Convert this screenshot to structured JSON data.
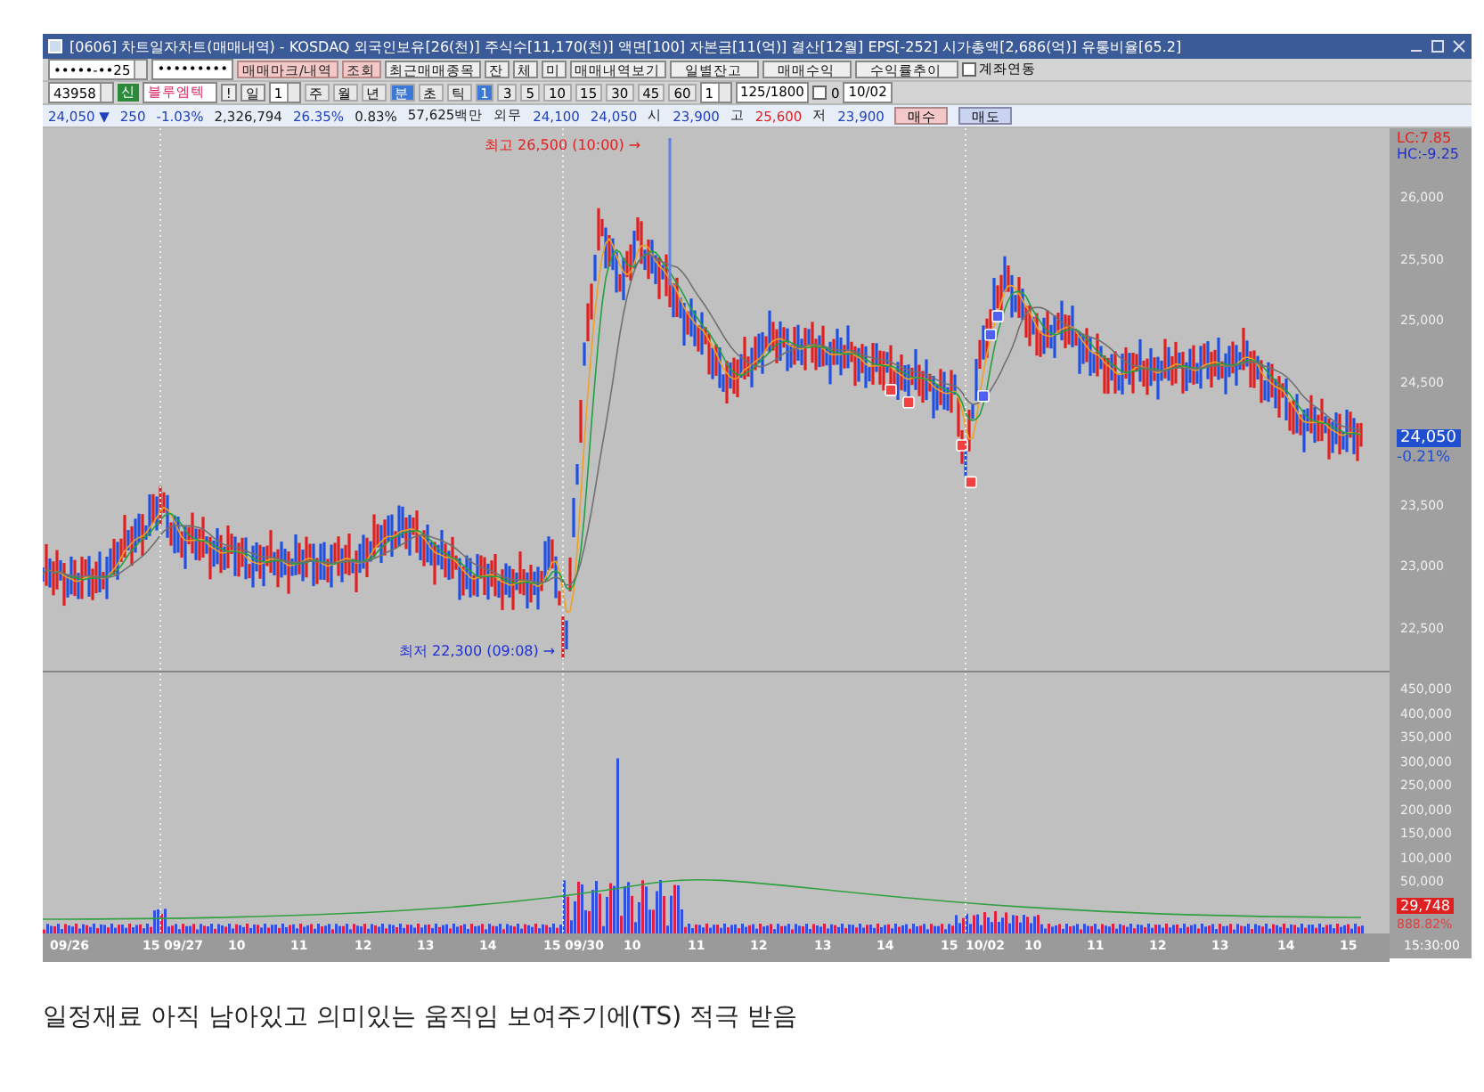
{
  "window": {
    "title": "[0606] 차트일자차트(매매내역) - KOSDAQ 외국인보유[26(천)] 주식수[11,170(천)] 액면[100] 자본금[11(억)] 결산[12월] EPS[-252] 시가총액[2,686(억)] 유통비율[65.2]"
  },
  "toolbar_1": [
    {
      "kind": "combo",
      "label": "•••••-••25"
    },
    {
      "kind": "field",
      "label": "•••••••••"
    },
    {
      "kind": "pink",
      "label": "매매마크/내역"
    },
    {
      "kind": "pink",
      "label": "조회"
    },
    {
      "kind": "button",
      "label": "최근매매종목"
    },
    {
      "kind": "button",
      "label": "잔"
    },
    {
      "kind": "button",
      "label": "체"
    },
    {
      "kind": "button",
      "label": "미"
    },
    {
      "kind": "button",
      "label": "매매내역보기"
    },
    {
      "kind": "wide",
      "label": "일별잔고"
    },
    {
      "kind": "wide",
      "label": "매매수익"
    },
    {
      "kind": "wide",
      "label": "수익률추이"
    },
    {
      "kind": "checkbox",
      "label": "계좌연동",
      "checked": false
    }
  ],
  "toolbar_2": [
    {
      "kind": "combo",
      "label": "43958"
    },
    {
      "kind": "badge",
      "label": "신"
    },
    {
      "kind": "name",
      "label": "블루엠텍"
    },
    {
      "kind": "button",
      "label": "!"
    },
    {
      "kind": "button",
      "label": "일"
    },
    {
      "kind": "combo",
      "label": "1"
    },
    {
      "kind": "period",
      "label": "주",
      "selected": false
    },
    {
      "kind": "period",
      "label": "월",
      "selected": false
    },
    {
      "kind": "period",
      "label": "년",
      "selected": false
    },
    {
      "kind": "period",
      "label": "분",
      "selected": true
    },
    {
      "kind": "period",
      "label": "초",
      "selected": false
    },
    {
      "kind": "period",
      "label": "틱",
      "selected": false
    },
    {
      "kind": "period",
      "label": "1",
      "selected": true
    },
    {
      "kind": "period",
      "label": "3",
      "selected": false
    },
    {
      "kind": "period",
      "label": "5",
      "selected": false
    },
    {
      "kind": "period",
      "label": "10",
      "selected": false
    },
    {
      "kind": "period",
      "label": "15",
      "selected": false
    },
    {
      "kind": "period",
      "label": "30",
      "selected": false
    },
    {
      "kind": "period",
      "label": "45",
      "selected": false
    },
    {
      "kind": "period",
      "label": "60",
      "selected": false
    },
    {
      "kind": "combo",
      "label": "1"
    },
    {
      "kind": "field",
      "label": "125/1800"
    },
    {
      "kind": "checkbox",
      "label": "0",
      "checked": false
    },
    {
      "kind": "date",
      "label": "10/02"
    }
  ],
  "quote": [
    {
      "text": "24,050 ▼",
      "color": "#2040c0"
    },
    {
      "text": "250",
      "color": "#2040c0"
    },
    {
      "text": "-1.03%",
      "color": "#2040c0"
    },
    {
      "text": "2,326,794",
      "color": "#202020"
    },
    {
      "text": "26.35%",
      "color": "#2040c0"
    },
    {
      "text": "0.83%",
      "color": "#202020"
    },
    {
      "text": "57,625백만",
      "color": "#202020"
    },
    {
      "text": "외무",
      "color": "#202020"
    },
    {
      "text": "24,100",
      "color": "#2040c0"
    },
    {
      "text": "24,050",
      "color": "#2040c0"
    },
    {
      "text": "시",
      "color": "#202020"
    },
    {
      "text": "23,900",
      "color": "#2040c0"
    },
    {
      "text": "고",
      "color": "#202020"
    },
    {
      "text": "25,600",
      "color": "#e02020"
    },
    {
      "text": "저",
      "color": "#202020"
    },
    {
      "text": "23,900",
      "color": "#2040c0"
    }
  ],
  "order_buttons": [
    "매수",
    "매도"
  ],
  "chart": {
    "high_label": "최고 26,500 (10:00) →",
    "low_label": "최저 22,300 (09:08) →",
    "lc": "LC:7.85",
    "hc": "HC:-9.25",
    "price_ticks": [
      "26,000",
      "25,500",
      "25,000",
      "24,500",
      "23,500",
      "23,000",
      "22,500"
    ],
    "current_price": "24,050",
    "current_change": "-0.21%",
    "volume_ticks": [
      "450,000",
      "400,000",
      "350,000",
      "300,000",
      "250,000",
      "200,000",
      "150,000",
      "100,000",
      "50,000"
    ],
    "current_volume": "29,748",
    "volume_ratio": "888.82%",
    "time_labels": [
      "09/26",
      "15",
      "09/27",
      "10",
      "11",
      "12",
      "13",
      "14",
      "15",
      "09/30",
      "10",
      "11",
      "12",
      "13",
      "14",
      "15",
      "10/02",
      "10",
      "11",
      "12",
      "13",
      "14",
      "15"
    ],
    "end_time": "15:30:00"
  },
  "caption": "일정재료 아직 남아있고 의미있는 움직임 보여주기에(TS) 적극 받음"
}
